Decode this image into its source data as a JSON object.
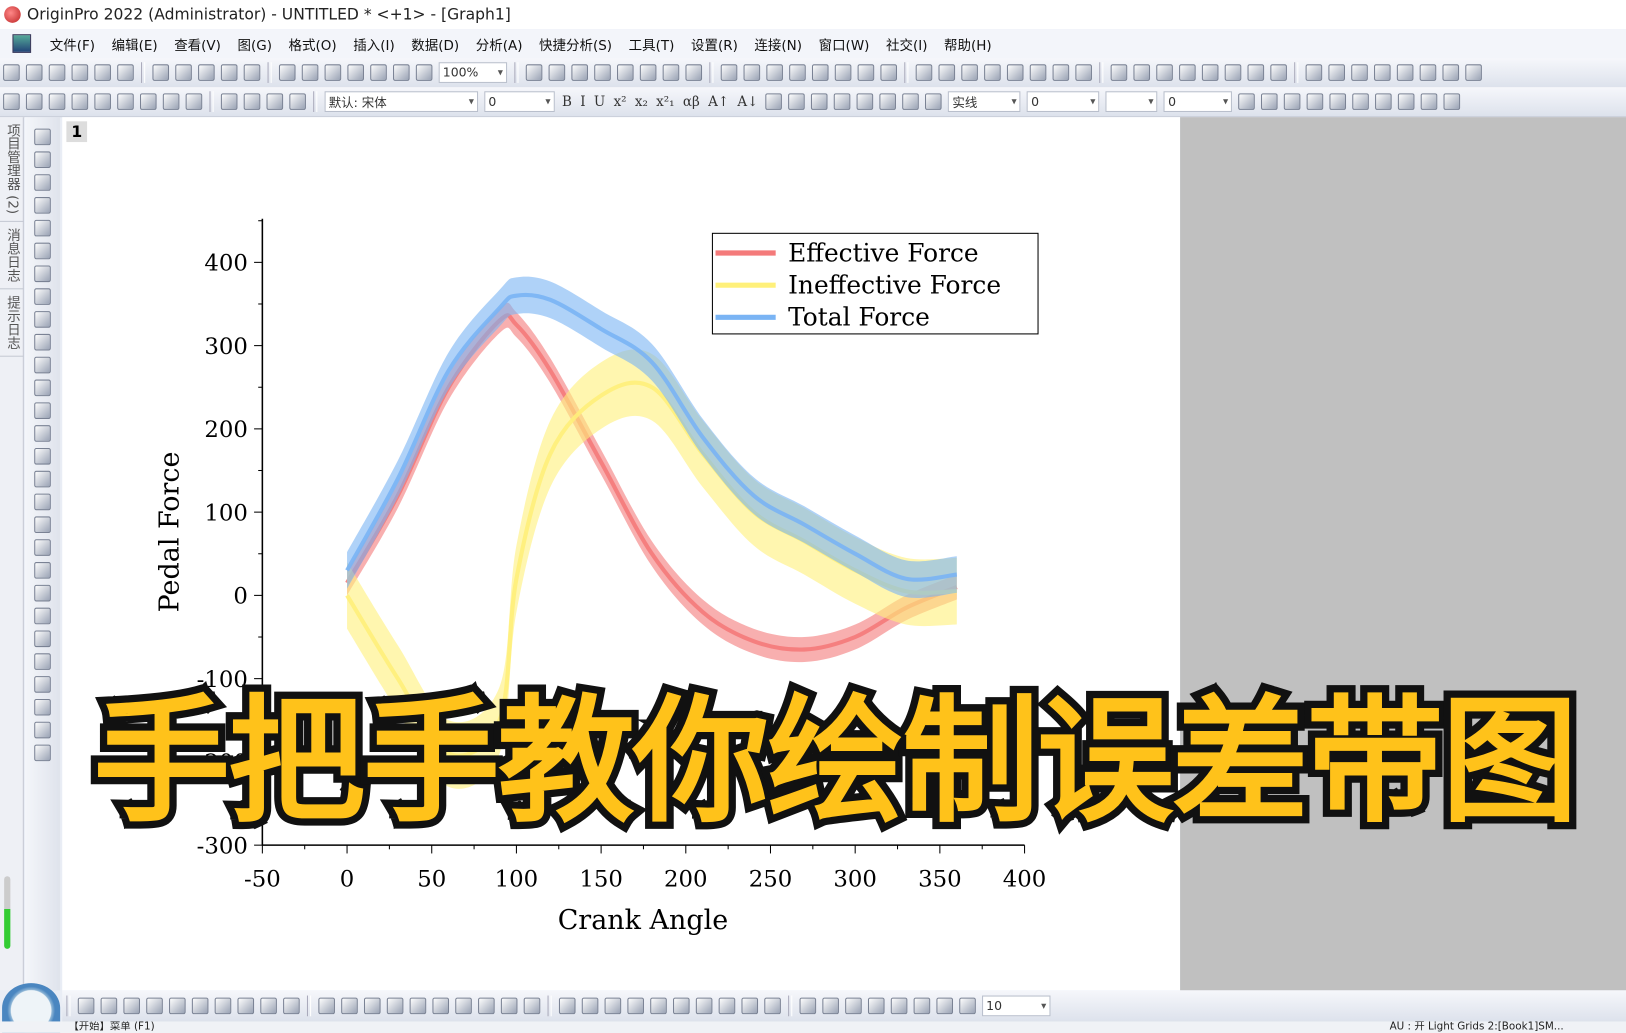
{
  "window": {
    "title": "OriginPro 2022 (Administrator) - UNTITLED * <+1> - [Graph1]"
  },
  "menu": [
    "文件(F)",
    "编辑(E)",
    "查看(V)",
    "图(G)",
    "格式(O)",
    "插入(I)",
    "数据(D)",
    "分析(A)",
    "快捷分析(S)",
    "工具(T)",
    "设置(R)",
    "连接(N)",
    "窗口(W)",
    "社交(I)",
    "帮助(H)"
  ],
  "toolbar1": {
    "zoom_value": "100%",
    "icon_count_a": 14,
    "icon_count_b": 40
  },
  "toolbar2": {
    "font_value": "默认: 宋体",
    "font_size": "0",
    "format_buttons": [
      "B",
      "I",
      "U",
      "x²",
      "x₂",
      "x²₁",
      "αβ",
      "A↑",
      "A↓"
    ],
    "line_style": "实线",
    "line_width": "0",
    "fill_value": "0"
  },
  "side_tabs": [
    "项目管理器 (2)",
    "消息日志",
    "提示日志"
  ],
  "graph": {
    "layer_label": "1"
  },
  "bottom_toolbar": {
    "size_value": "10"
  },
  "status": {
    "left": "【开始】菜单 (F1)",
    "right": "AU : 开  Light Grids  2:[Book1]SM..."
  },
  "banner": {
    "text": "手把手教你绘制误差带图",
    "fill_color": "#ffc21a",
    "stroke_color": "#111111"
  },
  "chart_data": {
    "type": "line",
    "subtype": "line with error band",
    "xlabel": "Crank Angle",
    "ylabel": "Pedal Force",
    "xlim": [
      -50,
      400
    ],
    "ylim": [
      -300,
      400
    ],
    "xticks": [
      -50,
      0,
      50,
      100,
      150,
      200,
      250,
      300,
      350,
      400
    ],
    "yticks": [
      -300,
      -200,
      -100,
      0,
      100,
      200,
      300,
      400
    ],
    "grid": false,
    "legend_position": "top-right",
    "x": [
      0,
      30,
      60,
      90,
      100,
      120,
      150,
      180,
      210,
      240,
      270,
      300,
      330,
      360
    ],
    "series": [
      {
        "name": "Effective Force",
        "color": "#f47a7a",
        "values": [
          15,
          120,
          250,
          330,
          325,
          270,
          160,
          50,
          -20,
          -55,
          -65,
          -50,
          -15,
          10
        ],
        "band": 15
      },
      {
        "name": "Ineffective Force",
        "color": "#fff07a",
        "values": [
          0,
          -100,
          -190,
          -150,
          20,
          170,
          240,
          250,
          170,
          100,
          65,
          30,
          5,
          5
        ],
        "band": 40
      },
      {
        "name": "Total Force",
        "color": "#7ab4f4",
        "values": [
          30,
          140,
          270,
          345,
          360,
          355,
          320,
          280,
          190,
          120,
          85,
          50,
          20,
          25
        ],
        "band": 22
      }
    ]
  }
}
